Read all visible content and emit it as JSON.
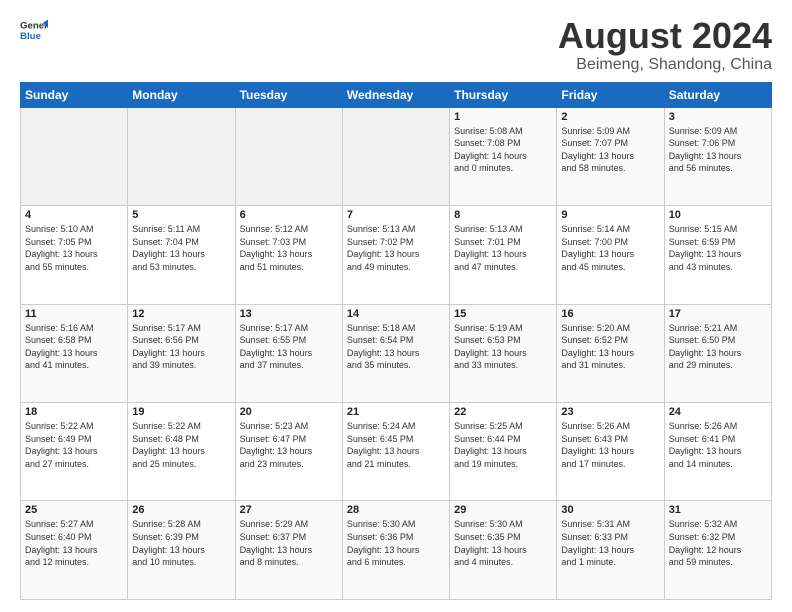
{
  "logo": {
    "line1": "General",
    "line2": "Blue"
  },
  "title": "August 2024",
  "subtitle": "Beimeng, Shandong, China",
  "weekdays": [
    "Sunday",
    "Monday",
    "Tuesday",
    "Wednesday",
    "Thursday",
    "Friday",
    "Saturday"
  ],
  "weeks": [
    [
      {
        "day": "",
        "info": ""
      },
      {
        "day": "",
        "info": ""
      },
      {
        "day": "",
        "info": ""
      },
      {
        "day": "",
        "info": ""
      },
      {
        "day": "1",
        "info": "Sunrise: 5:08 AM\nSunset: 7:08 PM\nDaylight: 14 hours\nand 0 minutes."
      },
      {
        "day": "2",
        "info": "Sunrise: 5:09 AM\nSunset: 7:07 PM\nDaylight: 13 hours\nand 58 minutes."
      },
      {
        "day": "3",
        "info": "Sunrise: 5:09 AM\nSunset: 7:06 PM\nDaylight: 13 hours\nand 56 minutes."
      }
    ],
    [
      {
        "day": "4",
        "info": "Sunrise: 5:10 AM\nSunset: 7:05 PM\nDaylight: 13 hours\nand 55 minutes."
      },
      {
        "day": "5",
        "info": "Sunrise: 5:11 AM\nSunset: 7:04 PM\nDaylight: 13 hours\nand 53 minutes."
      },
      {
        "day": "6",
        "info": "Sunrise: 5:12 AM\nSunset: 7:03 PM\nDaylight: 13 hours\nand 51 minutes."
      },
      {
        "day": "7",
        "info": "Sunrise: 5:13 AM\nSunset: 7:02 PM\nDaylight: 13 hours\nand 49 minutes."
      },
      {
        "day": "8",
        "info": "Sunrise: 5:13 AM\nSunset: 7:01 PM\nDaylight: 13 hours\nand 47 minutes."
      },
      {
        "day": "9",
        "info": "Sunrise: 5:14 AM\nSunset: 7:00 PM\nDaylight: 13 hours\nand 45 minutes."
      },
      {
        "day": "10",
        "info": "Sunrise: 5:15 AM\nSunset: 6:59 PM\nDaylight: 13 hours\nand 43 minutes."
      }
    ],
    [
      {
        "day": "11",
        "info": "Sunrise: 5:16 AM\nSunset: 6:58 PM\nDaylight: 13 hours\nand 41 minutes."
      },
      {
        "day": "12",
        "info": "Sunrise: 5:17 AM\nSunset: 6:56 PM\nDaylight: 13 hours\nand 39 minutes."
      },
      {
        "day": "13",
        "info": "Sunrise: 5:17 AM\nSunset: 6:55 PM\nDaylight: 13 hours\nand 37 minutes."
      },
      {
        "day": "14",
        "info": "Sunrise: 5:18 AM\nSunset: 6:54 PM\nDaylight: 13 hours\nand 35 minutes."
      },
      {
        "day": "15",
        "info": "Sunrise: 5:19 AM\nSunset: 6:53 PM\nDaylight: 13 hours\nand 33 minutes."
      },
      {
        "day": "16",
        "info": "Sunrise: 5:20 AM\nSunset: 6:52 PM\nDaylight: 13 hours\nand 31 minutes."
      },
      {
        "day": "17",
        "info": "Sunrise: 5:21 AM\nSunset: 6:50 PM\nDaylight: 13 hours\nand 29 minutes."
      }
    ],
    [
      {
        "day": "18",
        "info": "Sunrise: 5:22 AM\nSunset: 6:49 PM\nDaylight: 13 hours\nand 27 minutes."
      },
      {
        "day": "19",
        "info": "Sunrise: 5:22 AM\nSunset: 6:48 PM\nDaylight: 13 hours\nand 25 minutes."
      },
      {
        "day": "20",
        "info": "Sunrise: 5:23 AM\nSunset: 6:47 PM\nDaylight: 13 hours\nand 23 minutes."
      },
      {
        "day": "21",
        "info": "Sunrise: 5:24 AM\nSunset: 6:45 PM\nDaylight: 13 hours\nand 21 minutes."
      },
      {
        "day": "22",
        "info": "Sunrise: 5:25 AM\nSunset: 6:44 PM\nDaylight: 13 hours\nand 19 minutes."
      },
      {
        "day": "23",
        "info": "Sunrise: 5:26 AM\nSunset: 6:43 PM\nDaylight: 13 hours\nand 17 minutes."
      },
      {
        "day": "24",
        "info": "Sunrise: 5:26 AM\nSunset: 6:41 PM\nDaylight: 13 hours\nand 14 minutes."
      }
    ],
    [
      {
        "day": "25",
        "info": "Sunrise: 5:27 AM\nSunset: 6:40 PM\nDaylight: 13 hours\nand 12 minutes."
      },
      {
        "day": "26",
        "info": "Sunrise: 5:28 AM\nSunset: 6:39 PM\nDaylight: 13 hours\nand 10 minutes."
      },
      {
        "day": "27",
        "info": "Sunrise: 5:29 AM\nSunset: 6:37 PM\nDaylight: 13 hours\nand 8 minutes."
      },
      {
        "day": "28",
        "info": "Sunrise: 5:30 AM\nSunset: 6:36 PM\nDaylight: 13 hours\nand 6 minutes."
      },
      {
        "day": "29",
        "info": "Sunrise: 5:30 AM\nSunset: 6:35 PM\nDaylight: 13 hours\nand 4 minutes."
      },
      {
        "day": "30",
        "info": "Sunrise: 5:31 AM\nSunset: 6:33 PM\nDaylight: 13 hours\nand 1 minute."
      },
      {
        "day": "31",
        "info": "Sunrise: 5:32 AM\nSunset: 6:32 PM\nDaylight: 12 hours\nand 59 minutes."
      }
    ]
  ]
}
